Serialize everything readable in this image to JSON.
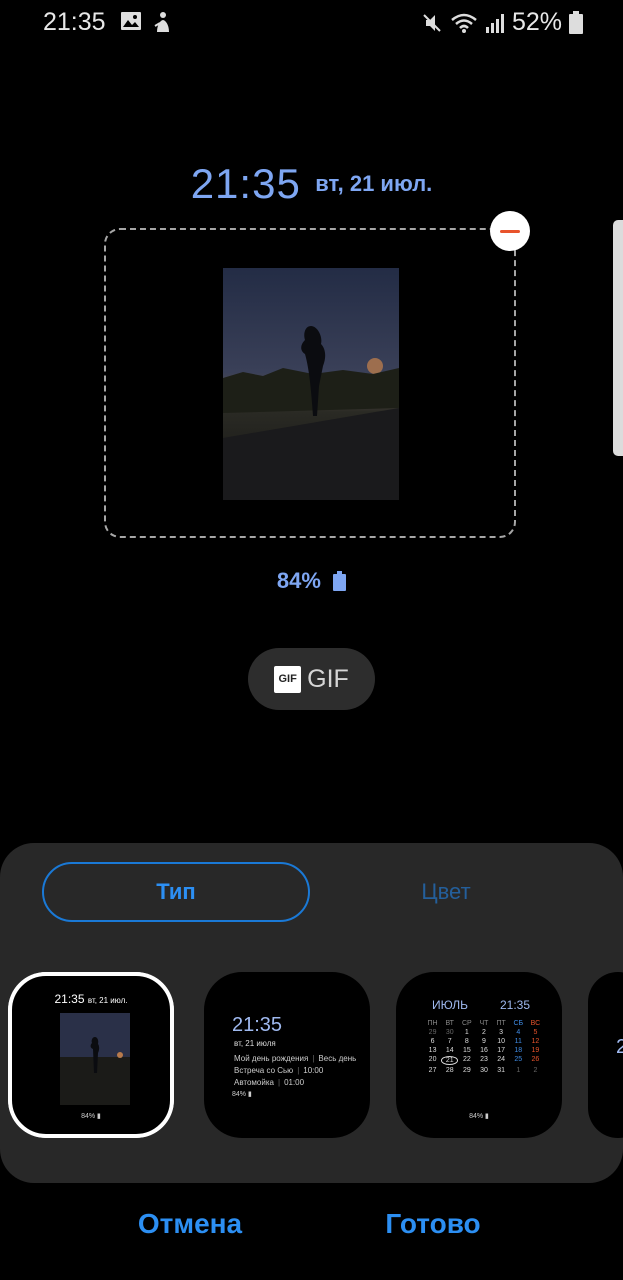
{
  "status_bar": {
    "time": "21:35",
    "battery_percent": "52%",
    "icons": [
      "gallery-icon",
      "notification-icon",
      "mute-icon",
      "wifi-icon",
      "signal-icon",
      "battery-icon"
    ]
  },
  "preview": {
    "time": "21:35",
    "date": "вт, 21 июл.",
    "battery": "84%",
    "gif_label": "GIF",
    "gif_badge": "GIF"
  },
  "tabs": [
    {
      "label": "Тип",
      "selected": true
    },
    {
      "label": "Цвет",
      "selected": false
    }
  ],
  "styles": {
    "card1": {
      "time": "21:35",
      "date": "вт, 21 июл.",
      "battery": "84%"
    },
    "card2": {
      "time": "21:35",
      "date": "вт, 21 июля",
      "events": [
        {
          "title": "Мой день рождения",
          "when": "Весь день"
        },
        {
          "title": "Встреча со Сью",
          "when": "10:00"
        },
        {
          "title": "Автомойка",
          "when": "01:00"
        }
      ],
      "battery": "84%"
    },
    "card3": {
      "month": "ИЮЛЬ",
      "time": "21:35",
      "weekdays": [
        "ПН",
        "ВТ",
        "СР",
        "ЧТ",
        "ПТ",
        "СБ",
        "ВС"
      ],
      "weeks": [
        [
          "29",
          "30",
          "1",
          "2",
          "3",
          "4",
          "5"
        ],
        [
          "6",
          "7",
          "8",
          "9",
          "10",
          "11",
          "12"
        ],
        [
          "13",
          "14",
          "15",
          "16",
          "17",
          "18",
          "19"
        ],
        [
          "20",
          "21",
          "22",
          "23",
          "24",
          "25",
          "26"
        ],
        [
          "27",
          "28",
          "29",
          "30",
          "31",
          "1",
          "2"
        ]
      ],
      "battery": "84%"
    },
    "card4": {
      "time": "2"
    }
  },
  "actions": {
    "cancel": "Отмена",
    "done": "Готово"
  },
  "colors": {
    "accent": "#2c8ff3",
    "clock_blue": "#7ea6f2",
    "remove": "#e8532b",
    "panel": "#282828"
  }
}
